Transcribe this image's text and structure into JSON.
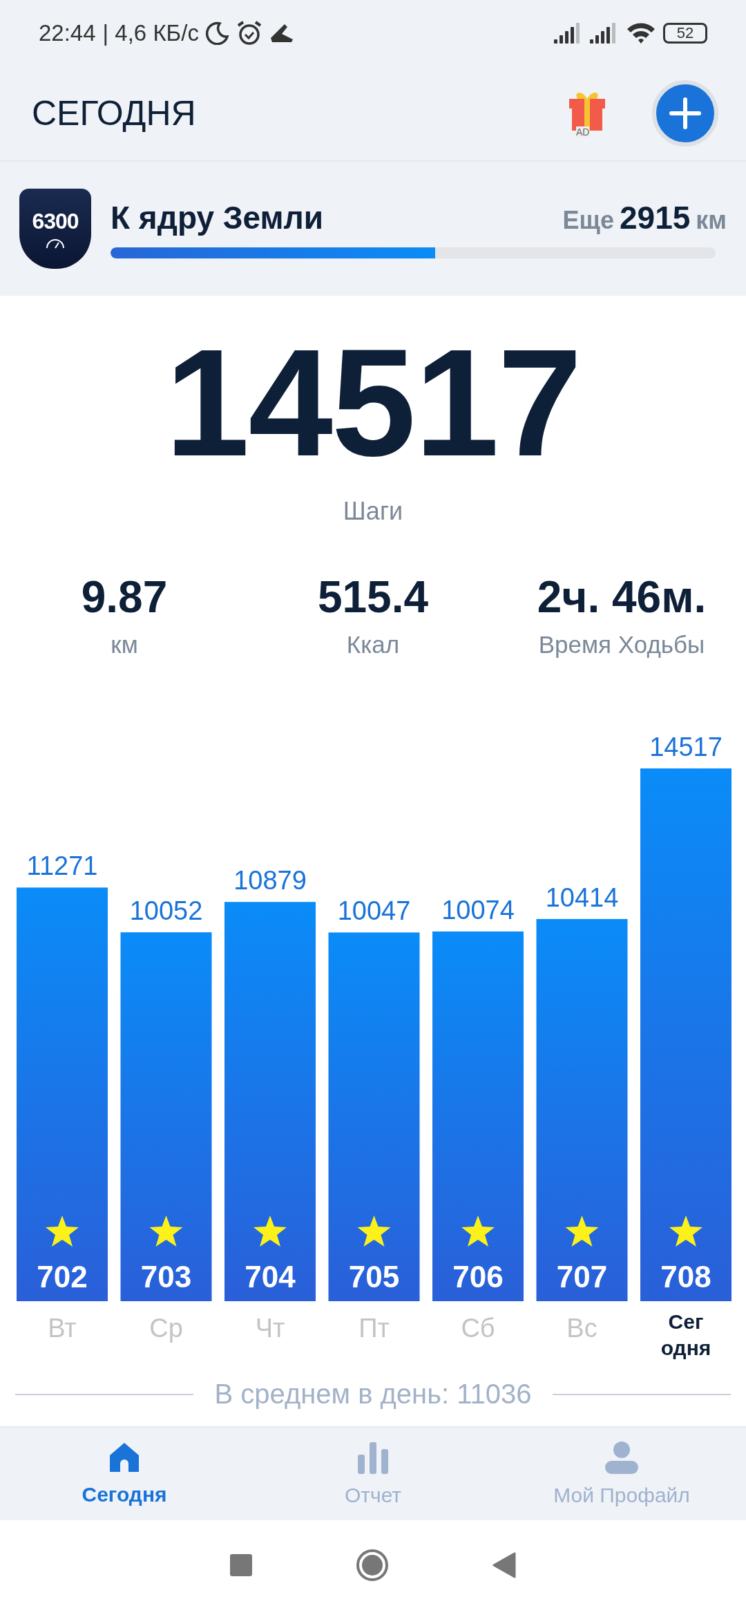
{
  "status_bar": {
    "time": "22:44",
    "speed": "| 4,6 КБ/с",
    "battery": "52"
  },
  "header": {
    "title": "СЕГОДНЯ",
    "gift_badge": "AD"
  },
  "goal": {
    "badge": "6300",
    "title": "К ядру Земли",
    "remaining_label": "Еще",
    "remaining_value": "2915",
    "remaining_unit": "км",
    "level": 0.536
  },
  "steps": {
    "value": "14517",
    "label": "Шаги"
  },
  "stats": [
    {
      "value": "9.87",
      "label": "км"
    },
    {
      "value": "515.4",
      "label": "Ккал"
    },
    {
      "value": "2ч. 46м.",
      "label": "Время Ходьбы"
    }
  ],
  "chart": {
    "chart_data": {
      "type": "bar",
      "categories": [
        "Вт",
        "Ср",
        "Чт",
        "Пт",
        "Сб",
        "Вс",
        "Сегодня"
      ],
      "values": [
        11271,
        10052,
        10879,
        10047,
        10074,
        10414,
        14517
      ],
      "value_labels": [
        "11271",
        "10052",
        "10879",
        "10047",
        "10074",
        "10414",
        "14517"
      ]
    },
    "badges": [
      "702",
      "703",
      "704",
      "705",
      "706",
      "707",
      "708"
    ],
    "day_states": [
      {
        "selected": false
      },
      {
        "selected": false
      },
      {
        "selected": false
      },
      {
        "selected": false
      },
      {
        "selected": false
      },
      {
        "selected": false
      },
      {
        "selected": true
      }
    ],
    "average": "В среднем в день: 11036"
  },
  "bottom_nav": [
    {
      "label": "Сегодня",
      "kind": "home",
      "selected": true
    },
    {
      "label": "Отчет",
      "kind": "chart",
      "selected": false
    },
    {
      "label": "Мой Профайл",
      "kind": "person",
      "selected": false
    }
  ]
}
